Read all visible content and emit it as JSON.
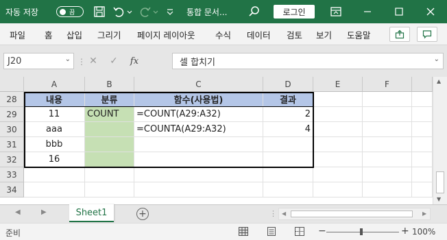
{
  "titlebar": {
    "autosave_label": "자동 저장",
    "toggle_state": "끔",
    "document_title": "통합 문서...",
    "login_label": "로그인"
  },
  "ribbon": {
    "tabs": [
      "파일",
      "홈",
      "삽입",
      "그리기",
      "페이지 레이아웃",
      "수식",
      "데이터",
      "검토",
      "보기",
      "도움말"
    ]
  },
  "formula_bar": {
    "name_box": "J20",
    "content": "셀 합치기"
  },
  "columns": [
    "A",
    "B",
    "C",
    "D",
    "E",
    "F"
  ],
  "rows": [
    {
      "num": "28",
      "A": "내용",
      "B": "분류",
      "C": "함수(사용법)",
      "D": "결과"
    },
    {
      "num": "29",
      "A": "11",
      "B": "COUNT",
      "C": "=COUNT(A29:A32)",
      "D": "2"
    },
    {
      "num": "30",
      "A": "aaa",
      "B": "",
      "C": "=COUNTA(A29:A32)",
      "D": "4"
    },
    {
      "num": "31",
      "A": "bbb",
      "B": "",
      "C": "",
      "D": ""
    },
    {
      "num": "32",
      "A": "16",
      "B": "",
      "C": "",
      "D": ""
    },
    {
      "num": "33",
      "A": "",
      "B": "",
      "C": "",
      "D": ""
    },
    {
      "num": "34",
      "A": "",
      "B": "",
      "C": "",
      "D": ""
    }
  ],
  "sheets": [
    "Sheet1"
  ],
  "status": {
    "ready": "준비",
    "zoom": "100%"
  },
  "colors": {
    "excel_green": "#217346",
    "header_blue": "#b4c6e7",
    "category_green": "#c6e0b4"
  }
}
